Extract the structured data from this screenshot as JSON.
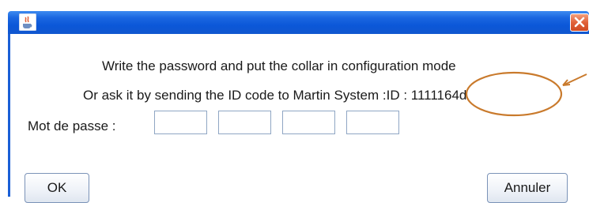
{
  "dialog": {
    "app_icon": "java-coffee-cup-icon",
    "close_icon": "close-icon",
    "message_line1": "Write the password and put the collar in configuration mode",
    "message_line2": "Or ask it by sending the ID code to Martin System :ID : 1111164d",
    "password_label": "Mot de passe :",
    "password_fields": [
      "",
      "",
      "",
      ""
    ],
    "ok_label": "OK",
    "cancel_label": "Annuler"
  },
  "colors": {
    "titlebar": "#0b57d8",
    "close_button": "#e0613a",
    "annotation": "#c97a2c"
  }
}
